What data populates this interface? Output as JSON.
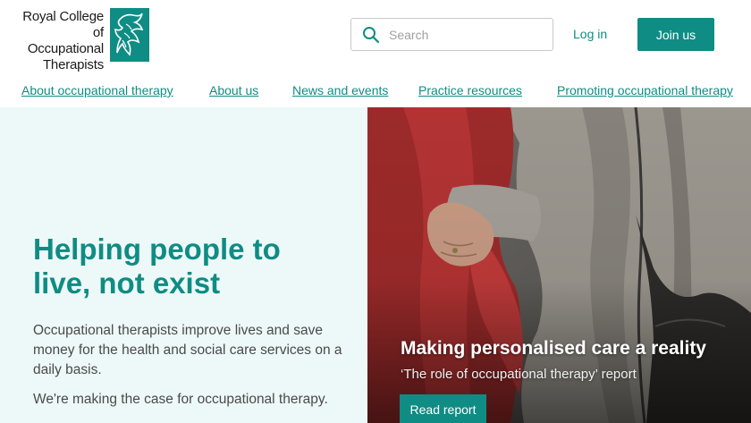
{
  "header": {
    "logo_lines": [
      "Royal College of",
      "Occupational",
      "Therapists"
    ],
    "search_placeholder": "Search",
    "login_label": "Log in",
    "join_label": "Join us"
  },
  "nav": {
    "items": [
      "About occupational therapy",
      "About us",
      "News and events",
      "Practice resources",
      "Promoting occupational therapy"
    ]
  },
  "hero": {
    "title_lines": [
      "Helping people to",
      "live, not exist"
    ],
    "description": "Occupational therapists improve lives and save money for the health and social care services on a daily basis.",
    "case_text": "We're making the case for occupational therapy."
  },
  "feature": {
    "title": "Making personalised care a reality",
    "subtitle": "‘The role of occupational therapy’ report",
    "button_label": "Read report"
  },
  "colors": {
    "brand": "#0f8c84",
    "hero_bg": "#edf9f8"
  },
  "icons": {
    "search": "search-icon",
    "logo": "rcot-logo-mark"
  }
}
